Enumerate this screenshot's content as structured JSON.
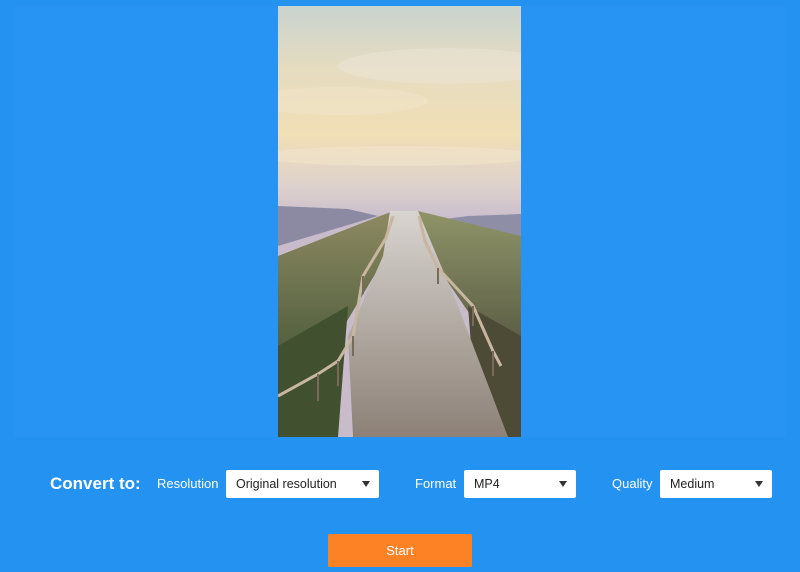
{
  "convert": {
    "label": "Convert to:",
    "resolution": {
      "label": "Resolution",
      "value": "Original resolution"
    },
    "format": {
      "label": "Format",
      "value": "MP4"
    },
    "quality": {
      "label": "Quality",
      "value": "Medium"
    }
  },
  "start_button": {
    "label": "Start"
  },
  "colors": {
    "background": "#2492f1",
    "accent": "#fd8226"
  },
  "icons": {
    "dropdown": "chevron-down-icon"
  }
}
